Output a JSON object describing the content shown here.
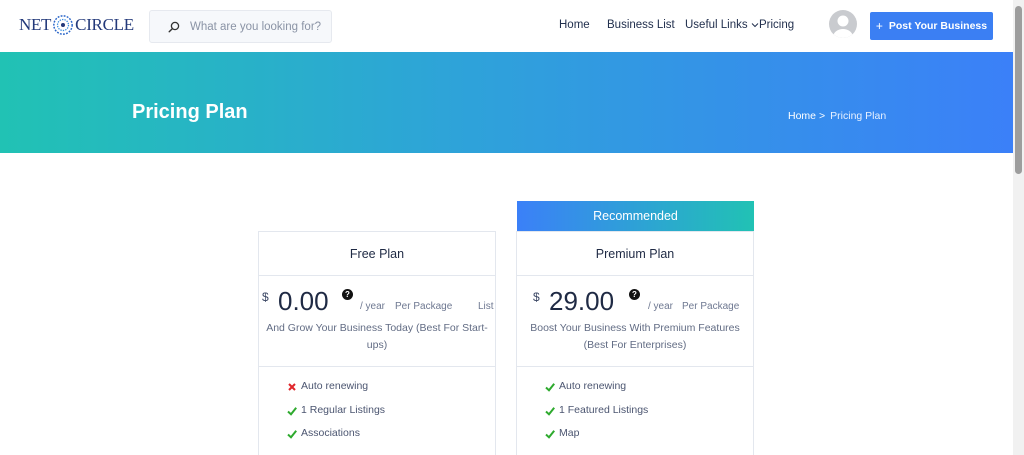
{
  "header": {
    "logo_left": "NET",
    "logo_right": "CIRCLE",
    "search_placeholder": "What are you looking for?",
    "nav": {
      "home": "Home",
      "business_list": "Business List",
      "useful_links": "Useful Links",
      "pricing": "Pricing"
    },
    "post_button": "Post Your Business"
  },
  "hero": {
    "title": "Pricing Plan",
    "breadcrumb_home": "Home",
    "breadcrumb_sep": ">",
    "breadcrumb_current": "Pricing Plan"
  },
  "plans": [
    {
      "name": "Free Plan",
      "currency": "$",
      "price": "0.00",
      "help": "?",
      "period": "/ year",
      "unit": "Per Package",
      "extra": "List",
      "description": "And Grow Your Business Today (Best For Start-ups)",
      "features": [
        {
          "label": "Auto renewing",
          "included": false
        },
        {
          "label": "1 Regular Listings",
          "included": true
        },
        {
          "label": "Associations",
          "included": true
        }
      ]
    },
    {
      "recommended_label": "Recommended",
      "name": "Premium Plan",
      "currency": "$",
      "price": "29.00",
      "help": "?",
      "period": "/ year",
      "unit": "Per Package",
      "description": "Boost Your Business With Premium Features (Best For Enterprises)",
      "features": [
        {
          "label": "Auto renewing",
          "included": true
        },
        {
          "label": "1 Featured Listings",
          "included": true
        },
        {
          "label": "Map",
          "included": true
        }
      ]
    }
  ],
  "colors": {
    "accent": "#3b7ff3",
    "gradient_start": "#21c2b4",
    "gradient_end": "#3b80f8",
    "check": "#2eaa2e",
    "cross": "#e0262b"
  }
}
